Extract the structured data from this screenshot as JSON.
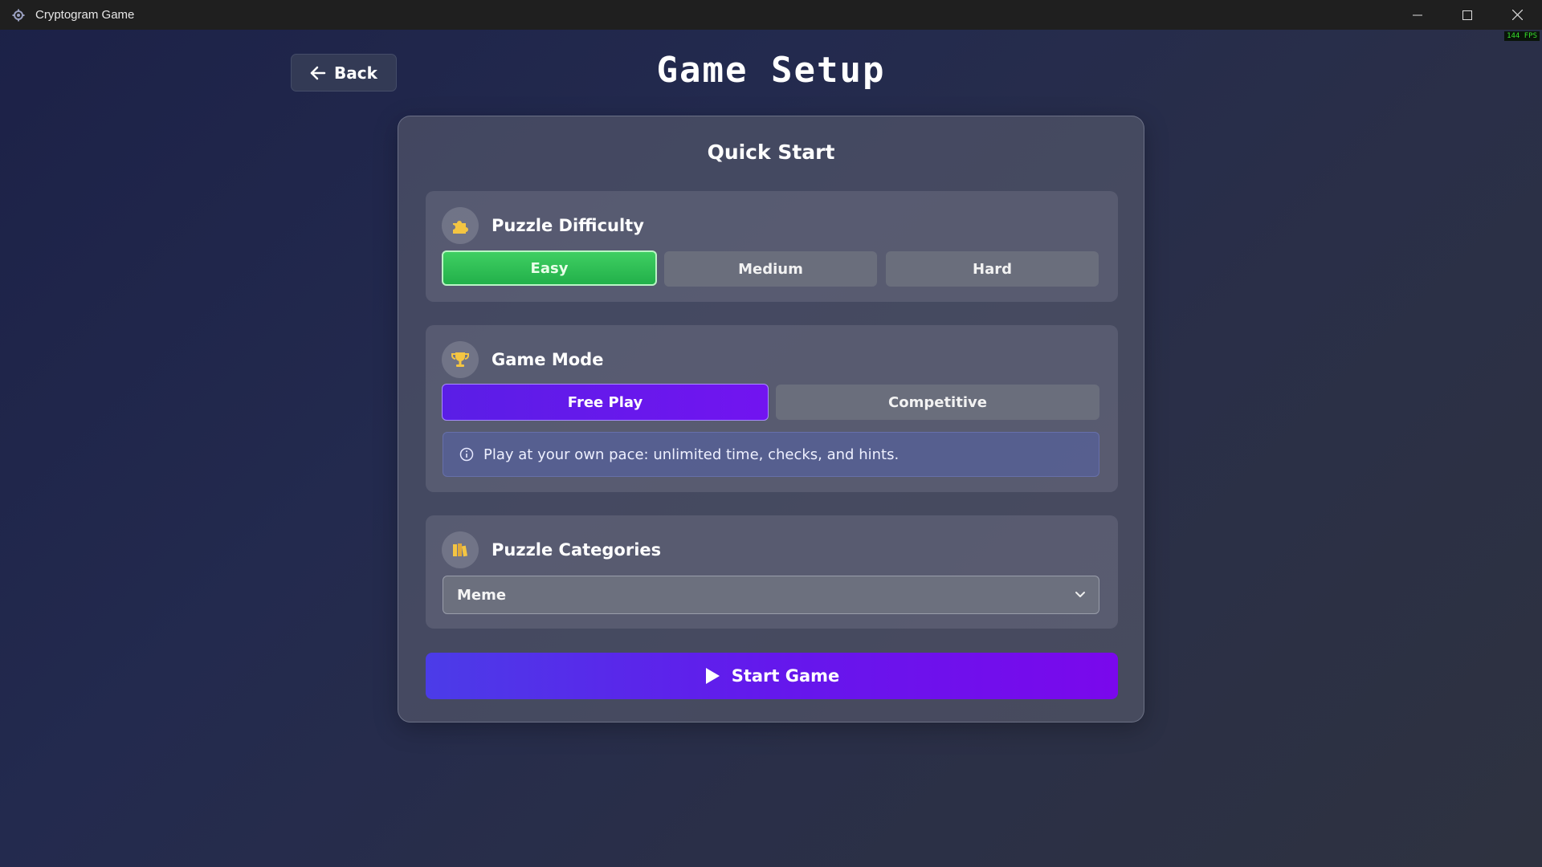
{
  "window": {
    "title": "Cryptogram Game",
    "fps": "144 FPS"
  },
  "header": {
    "back_label": "Back",
    "title": "Game Setup"
  },
  "card": {
    "title": "Quick Start",
    "difficulty": {
      "label": "Puzzle Difficulty",
      "icon": "puzzle-piece-icon",
      "options": [
        "Easy",
        "Medium",
        "Hard"
      ],
      "selected": "Easy"
    },
    "mode": {
      "label": "Game Mode",
      "icon": "trophy-icon",
      "options": [
        "Free Play",
        "Competitive"
      ],
      "selected": "Free Play",
      "info": "Play at your own pace: unlimited time, checks, and hints."
    },
    "categories": {
      "label": "Puzzle Categories",
      "icon": "books-icon",
      "selected": "Meme"
    },
    "start_label": "Start Game"
  },
  "colors": {
    "easy_active": "#2fbf55",
    "mode_active": "#6418ec",
    "start_gradient": [
      "#4b3ce8",
      "#7a08ec"
    ]
  }
}
